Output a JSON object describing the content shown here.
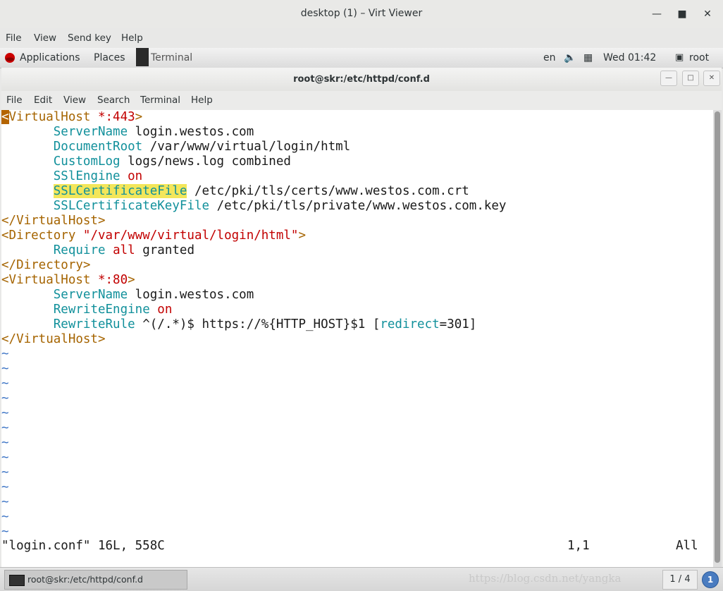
{
  "viewer": {
    "title": "desktop (1) – Virt Viewer",
    "menu": [
      "File",
      "View",
      "Send key",
      "Help"
    ]
  },
  "panel": {
    "applications": "Applications",
    "places": "Places",
    "terminal_task": "Terminal",
    "lang": "en",
    "clock": "Wed 01:42",
    "user": "root"
  },
  "terminal": {
    "title": "root@skr:/etc/httpd/conf.d",
    "menu": [
      "File",
      "Edit",
      "View",
      "Search",
      "Terminal",
      "Help"
    ]
  },
  "vim": {
    "lines": [
      [
        {
          "t": "<",
          "c": "cur"
        },
        {
          "t": "VirtualHost ",
          "c": "tag"
        },
        {
          "t": "*:443",
          "c": "val"
        },
        {
          "t": ">",
          "c": "tag"
        }
      ],
      [
        {
          "t": "       "
        },
        {
          "t": "ServerName",
          "c": "kw"
        },
        {
          "t": " login.westos.com"
        }
      ],
      [
        {
          "t": "       "
        },
        {
          "t": "DocumentRoot",
          "c": "kw"
        },
        {
          "t": " /var/www/virtual/login/html"
        }
      ],
      [
        {
          "t": "       "
        },
        {
          "t": "CustomLog",
          "c": "kw"
        },
        {
          "t": " logs/news.log combined"
        }
      ],
      [
        {
          "t": "       "
        },
        {
          "t": "SSlEngine",
          "c": "kw"
        },
        {
          "t": " "
        },
        {
          "t": "on",
          "c": "val"
        }
      ],
      [
        {
          "t": "       "
        },
        {
          "t": "SSLCertificateFile",
          "c": "kw hl"
        },
        {
          "t": " /etc/pki/tls/certs/www.westos.com.crt"
        }
      ],
      [
        {
          "t": "       "
        },
        {
          "t": "SSLCertificateKeyFile",
          "c": "kw"
        },
        {
          "t": " /etc/pki/tls/private/www.westos.com.key"
        }
      ],
      [
        {
          "t": "</VirtualHost>",
          "c": "tag"
        }
      ],
      [
        {
          "t": "<Directory ",
          "c": "tag"
        },
        {
          "t": "\"/var/www/virtual/login/html\"",
          "c": "val"
        },
        {
          "t": ">",
          "c": "tag"
        }
      ],
      [
        {
          "t": "       "
        },
        {
          "t": "Require",
          "c": "kw"
        },
        {
          "t": " "
        },
        {
          "t": "all",
          "c": "val"
        },
        {
          "t": " granted"
        }
      ],
      [
        {
          "t": "</Directory>",
          "c": "tag"
        }
      ],
      [
        {
          "t": "<VirtualHost ",
          "c": "tag"
        },
        {
          "t": "*:80",
          "c": "val"
        },
        {
          "t": ">",
          "c": "tag"
        }
      ],
      [
        {
          "t": "       "
        },
        {
          "t": "ServerName",
          "c": "kw"
        },
        {
          "t": " login.westos.com"
        }
      ],
      [
        {
          "t": "       "
        },
        {
          "t": "RewriteEngine",
          "c": "kw"
        },
        {
          "t": " "
        },
        {
          "t": "on",
          "c": "val"
        }
      ],
      [
        {
          "t": "       "
        },
        {
          "t": "RewriteRule",
          "c": "kw"
        },
        {
          "t": " ^(/.*)$ https://%{HTTP_HOST}$1 ["
        },
        {
          "t": "redirect",
          "c": "kw"
        },
        {
          "t": "=301]"
        }
      ],
      [
        {
          "t": "</VirtualHost>",
          "c": "tag"
        }
      ],
      [
        {
          "t": "~",
          "c": "tilde"
        }
      ],
      [
        {
          "t": "~",
          "c": "tilde"
        }
      ],
      [
        {
          "t": "~",
          "c": "tilde"
        }
      ],
      [
        {
          "t": "~",
          "c": "tilde"
        }
      ],
      [
        {
          "t": "~",
          "c": "tilde"
        }
      ],
      [
        {
          "t": "~",
          "c": "tilde"
        }
      ],
      [
        {
          "t": "~",
          "c": "tilde"
        }
      ],
      [
        {
          "t": "~",
          "c": "tilde"
        }
      ],
      [
        {
          "t": "~",
          "c": "tilde"
        }
      ],
      [
        {
          "t": "~",
          "c": "tilde"
        }
      ],
      [
        {
          "t": "~",
          "c": "tilde"
        }
      ],
      [
        {
          "t": "~",
          "c": "tilde"
        }
      ],
      [
        {
          "t": "~",
          "c": "tilde"
        }
      ]
    ],
    "status_file": "\"login.conf\" 16L, 558C",
    "status_pos": "1,1",
    "status_scroll": "All"
  },
  "taskbar": {
    "task_label": "root@skr:/etc/httpd/conf.d",
    "watermark": "https://blog.csdn.net/yangka",
    "workspace": "1 / 4",
    "notification_count": "1"
  }
}
